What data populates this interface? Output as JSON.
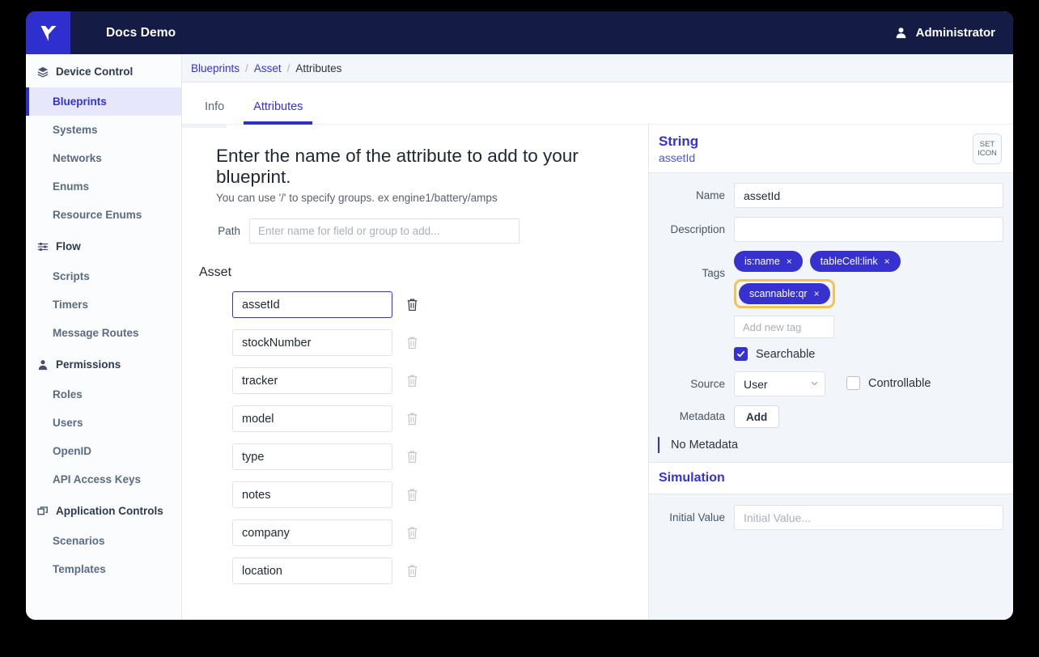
{
  "window": {
    "topbar": {
      "logo_icon": "brand-v-logo-icon",
      "app_title": "Docs Demo",
      "user_icon": "user-icon",
      "user_name": "Administrator"
    }
  },
  "sidebar": {
    "groups": [
      {
        "label": "Device Control",
        "icon": "layers-icon",
        "items": [
          {
            "label": "Blueprints",
            "active": true
          },
          {
            "label": "Systems",
            "active": false
          },
          {
            "label": "Networks",
            "active": false
          },
          {
            "label": "Enums",
            "active": false
          },
          {
            "label": "Resource Enums",
            "active": false
          }
        ]
      },
      {
        "label": "Flow",
        "icon": "sliders-icon",
        "items": [
          {
            "label": "Scripts",
            "active": false
          },
          {
            "label": "Timers",
            "active": false
          },
          {
            "label": "Message Routes",
            "active": false
          }
        ]
      },
      {
        "label": "Permissions",
        "icon": "person-icon",
        "items": [
          {
            "label": "Roles",
            "active": false
          },
          {
            "label": "Users",
            "active": false
          },
          {
            "label": "OpenID",
            "active": false
          },
          {
            "label": "API Access Keys",
            "active": false
          }
        ]
      },
      {
        "label": "Application Controls",
        "icon": "windows-icon",
        "items": [
          {
            "label": "Scenarios",
            "active": false
          },
          {
            "label": "Templates",
            "active": false
          }
        ]
      }
    ]
  },
  "breadcrumb": {
    "items": [
      "Blueprints",
      "Asset",
      "Attributes"
    ],
    "separator": "/"
  },
  "tabs": [
    {
      "label": "Info",
      "active": false
    },
    {
      "label": "Attributes",
      "active": true
    }
  ],
  "center": {
    "headline": "Enter the name of the attribute to add to your blueprint.",
    "subline": "You can use '/' to specify groups. ex engine1/battery/amps",
    "path_label": "Path",
    "path_value": "",
    "path_placeholder": "Enter name for field or group to add...",
    "group_title": "Asset",
    "attributes": [
      {
        "name": "assetId",
        "selected": true,
        "delete_icon": "trash-icon"
      },
      {
        "name": "stockNumber",
        "selected": false,
        "delete_icon": "trash-icon"
      },
      {
        "name": "tracker",
        "selected": false,
        "delete_icon": "trash-icon"
      },
      {
        "name": "model",
        "selected": false,
        "delete_icon": "trash-icon"
      },
      {
        "name": "type",
        "selected": false,
        "delete_icon": "trash-icon"
      },
      {
        "name": "notes",
        "selected": false,
        "delete_icon": "trash-icon"
      },
      {
        "name": "company",
        "selected": false,
        "delete_icon": "trash-icon"
      },
      {
        "name": "location",
        "selected": false,
        "delete_icon": "trash-icon"
      }
    ]
  },
  "inspector": {
    "type": "String",
    "name_subtitle": "assetId",
    "set_icon_button_line1": "SET",
    "set_icon_button_line2": "ICON",
    "name_label": "Name",
    "name_value": "assetId",
    "description_label": "Description",
    "description_value": "",
    "tags_label": "Tags",
    "tags": [
      {
        "label": "is:name",
        "remove": "×",
        "highlighted": false
      },
      {
        "label": "tableCell:link",
        "remove": "×",
        "highlighted": false
      },
      {
        "label": "scannable:qr",
        "remove": "×",
        "highlighted": true
      }
    ],
    "new_tag_placeholder": "Add new tag",
    "new_tag_value": "",
    "searchable_label": "Searchable",
    "searchable_checked": true,
    "source_label": "Source",
    "source_value": "User",
    "source_options": [
      "User"
    ],
    "controllable_label": "Controllable",
    "controllable_checked": false,
    "metadata_label": "Metadata",
    "metadata_add_label": "Add",
    "no_metadata_text": "No Metadata",
    "simulation_title": "Simulation",
    "initial_value_label": "Initial Value",
    "initial_value": "",
    "initial_value_placeholder": "Initial Value..."
  },
  "colors": {
    "brand_blue": "#2f2fd0",
    "topbar_navy": "#141c46",
    "accent_link": "#3531d6",
    "tag_bg": "#3731cf",
    "highlight_gold": "#f1c15c",
    "panel_bg": "#f2f5fa"
  }
}
